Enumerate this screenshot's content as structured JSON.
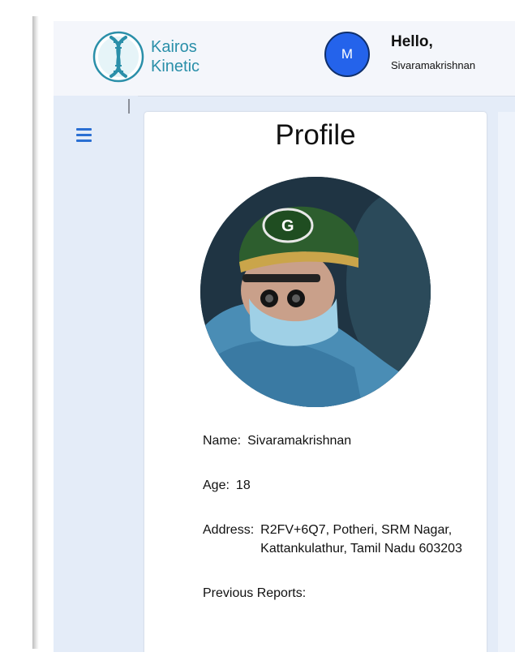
{
  "brand": {
    "line1": "Kairos",
    "line2": "Kinetic",
    "accent": "#2a8fa9"
  },
  "user": {
    "avatar_letter": "M",
    "greeting": "Hello,",
    "name": "Sivaramakrishnan"
  },
  "page": {
    "title": "Profile"
  },
  "profile": {
    "name_label": "Name:",
    "name_value": "Sivaramakrishnan",
    "age_label": "Age:",
    "age_value": "18",
    "address_label": "Address:",
    "address_value": "R2FV+6Q7, Potheri, SRM Nagar, Kattankulathur, Tamil Nadu 603203",
    "previous_reports_label": "Previous Reports:"
  },
  "icons": {
    "menu": "hamburger-menu-icon",
    "logo": "dna-logo-icon",
    "photo": "surgeon-profile-photo"
  },
  "colors": {
    "avatar_bg": "#2463eb",
    "menu_icon": "#2a6fd3",
    "page_bg": "#e4ecf8"
  }
}
